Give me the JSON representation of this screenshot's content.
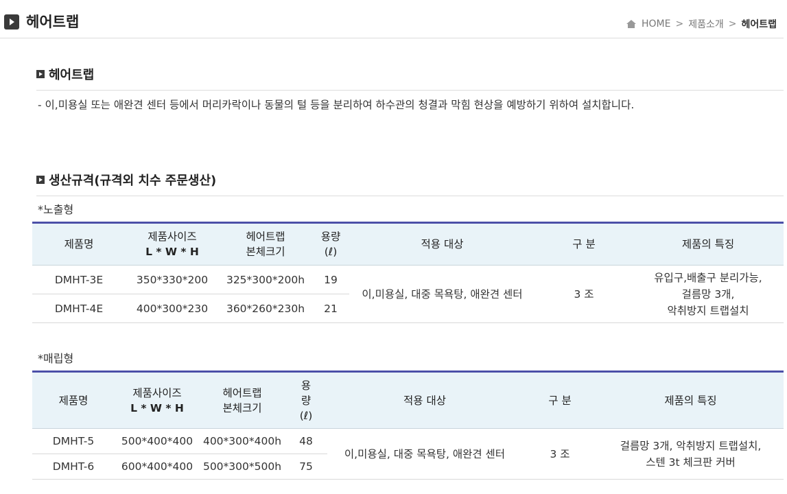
{
  "header": {
    "title": "헤어트랩",
    "breadcrumb": {
      "home": "HOME",
      "category": "제품소개",
      "current": "헤어트랩"
    }
  },
  "intro": {
    "heading": "헤어트랩",
    "description": "- 이,미용실 또는 애완견 센터 등에서 머리카락이나 동물의 털 등을 분리하여 하수관의 청결과 막힘 현상을 예방하기 위하여 설치합니다."
  },
  "spec": {
    "heading": "생산규격(규격외 치수 주문생산)",
    "exposed": {
      "label": "*노출형",
      "headers": {
        "name": "제품명",
        "size_line1": "제품사이즈",
        "size_line2": "L * W * H",
        "body_line1": "헤어트랩",
        "body_line2": "본체크기",
        "cap_line1": "용량",
        "cap_line2": "(ℓ)",
        "target": "적용 대상",
        "division": "구 분",
        "feature": "제품의 특징"
      },
      "rows": [
        {
          "name": "DMHT-3E",
          "size": "350*330*200",
          "body": "325*300*200h",
          "capacity": "19"
        },
        {
          "name": "DMHT-4E",
          "size": "400*300*230",
          "body": "360*260*230h",
          "capacity": "21"
        }
      ],
      "target": "이,미용실, 대중 목욕탕, 애완견 센터",
      "division": "3 조",
      "feature_line1": "유입구,배출구 분리가능,",
      "feature_line2": "걸름망 3개,",
      "feature_line3": "악취방지 트랩설치"
    },
    "buried": {
      "label": "*매립형",
      "headers": {
        "name": "제품명",
        "size_line1": "제품사이즈",
        "size_line2": "L * W * H",
        "body_line1": "헤어트랩",
        "body_line2": "본체크기",
        "cap_line1": "용",
        "cap_line2": "량",
        "cap_line3": "(ℓ)",
        "target": "적용 대상",
        "division": "구 분",
        "feature": "제품의 특징"
      },
      "rows": [
        {
          "name": "DMHT-5",
          "size": "500*400*400",
          "body": "400*300*400h",
          "capacity": "48"
        },
        {
          "name": "DMHT-6",
          "size": "600*400*400",
          "body": "500*300*500h",
          "capacity": "75"
        }
      ],
      "target": "이,미용실, 대중 목욕탕, 애완견 센터",
      "division": "3 조",
      "feature_line1": "걸름망 3개, 악취방지 트랩설치,",
      "feature_line2": "스텐 3t 체크판 커버"
    }
  }
}
